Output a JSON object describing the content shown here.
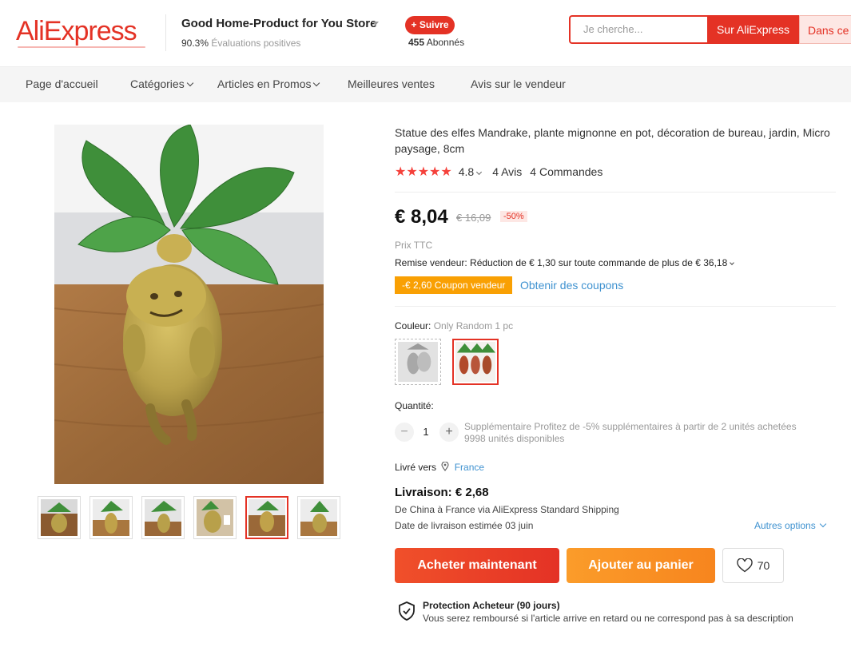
{
  "brand": {
    "logo": "AliExpress"
  },
  "store": {
    "name": "Good Home-Product for You Store",
    "rating_value": "90.3%",
    "rating_label": "Évaluations positives",
    "follow_label": "+ Suivre",
    "followers_count": "455",
    "followers_label": "Abonnés"
  },
  "search": {
    "placeholder": "Je cherche...",
    "btn_aliexpress": "Sur AliExpress",
    "btn_store": "Dans ce"
  },
  "nav": {
    "items": [
      {
        "label": "Page d'accueil",
        "dropdown": false
      },
      {
        "label": "Catégories",
        "dropdown": true
      },
      {
        "label": "Articles en Promos",
        "dropdown": true
      },
      {
        "label": "Meilleures ventes",
        "dropdown": false
      },
      {
        "label": "Avis sur le vendeur",
        "dropdown": false
      }
    ]
  },
  "product": {
    "title": "Statue des elfes Mandrake, plante mignonne en pot, décoration de bureau, jardin, Micro paysage, 8cm",
    "stars": "★★★★★",
    "rating": "4.8",
    "reviews": "4 Avis",
    "orders": "4 Commandes",
    "price": "€ 8,04",
    "old_price": "€ 16,09",
    "discount": "-50%",
    "tax": "Prix TTC",
    "remise": "Remise vendeur: Réduction de € 1,30 sur toute commande de plus de € 36,18",
    "coupon": "-€ 2,60 Coupon vendeur",
    "coupon_link": "Obtenir des coupons",
    "color_label": "Couleur:",
    "color_value": "Only Random 1 pc",
    "qty_label": "Quantité:",
    "qty_minus": "−",
    "qty_value": "1",
    "qty_plus": "+",
    "qty_promo": "Supplémentaire Profitez de -5% supplémentaires à partir de 2 unités achetées",
    "qty_available": "9998 unités disponibles"
  },
  "shipping": {
    "deliver_label": "Livré vers",
    "country": "France",
    "price": "Livraison: € 2,68",
    "route": "De China à France via AliExpress Standard Shipping",
    "date": "Date de livraison estimée 03 juin",
    "more_options": "Autres options"
  },
  "actions": {
    "buy_now": "Acheter maintenant",
    "add_to_cart": "Ajouter au panier",
    "wishlist_count": "70"
  },
  "protection": {
    "title": "Protection Acheteur (90 jours)",
    "text": "Vous serez remboursé si l'article arrive en retard ou ne correspond pas à sa description"
  },
  "colors": {
    "accent": "#e43225",
    "coupon": "#f9a003",
    "link": "#3f92d0",
    "cart": "#f7851e"
  }
}
